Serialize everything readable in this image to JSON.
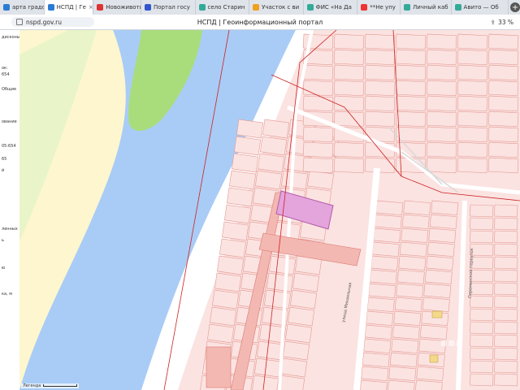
{
  "browser": {
    "tabs": [
      {
        "label": "арта градо",
        "color": "#2a7bd3",
        "active": false
      },
      {
        "label": "НСПД | Ге",
        "color": "#2a7bd3",
        "active": true
      },
      {
        "label": "Новоживоти",
        "color": "#d33",
        "active": false
      },
      {
        "label": "Портал госу",
        "color": "#3355cc",
        "active": false
      },
      {
        "label": "село Старин",
        "color": "#3a9",
        "active": false
      },
      {
        "label": "Участок с ви",
        "color": "#f0a020",
        "active": false
      },
      {
        "label": "ФИС «На Да",
        "color": "#3a9",
        "active": false
      },
      {
        "label": "**Не упу",
        "color": "#e33",
        "active": false
      },
      {
        "label": "Личный каб",
        "color": "#3a9",
        "active": false
      },
      {
        "label": "Авито — Об",
        "color": "#3a9",
        "active": false
      }
    ],
    "new_tab": "+",
    "url": "nspd.gov.ru",
    "page_title": "НСПД | Геоинформационный портал",
    "zoom": "33 %"
  },
  "side_panel": {
    "lines": [
      "дисконый",
      "ок:",
      "654",
      "Общие",
      "ование",
      "05:654",
      "65",
      "й",
      "ленных",
      "ь",
      "ю",
      "ка, м"
    ]
  },
  "map": {
    "streets": [
      "улица Михаильная",
      "Переменский переулок"
    ],
    "scale_label": "Легенда",
    "colors": {
      "water": "#a9ccf6",
      "grass": "#a9dd7c",
      "land_light": "#fdf6cf",
      "parcel_fill": "#fbe3e1",
      "parcel_border": "#e39a94",
      "selected": "#e4a4dc",
      "road": "#ffffff",
      "boundary": "#cc2222"
    }
  }
}
